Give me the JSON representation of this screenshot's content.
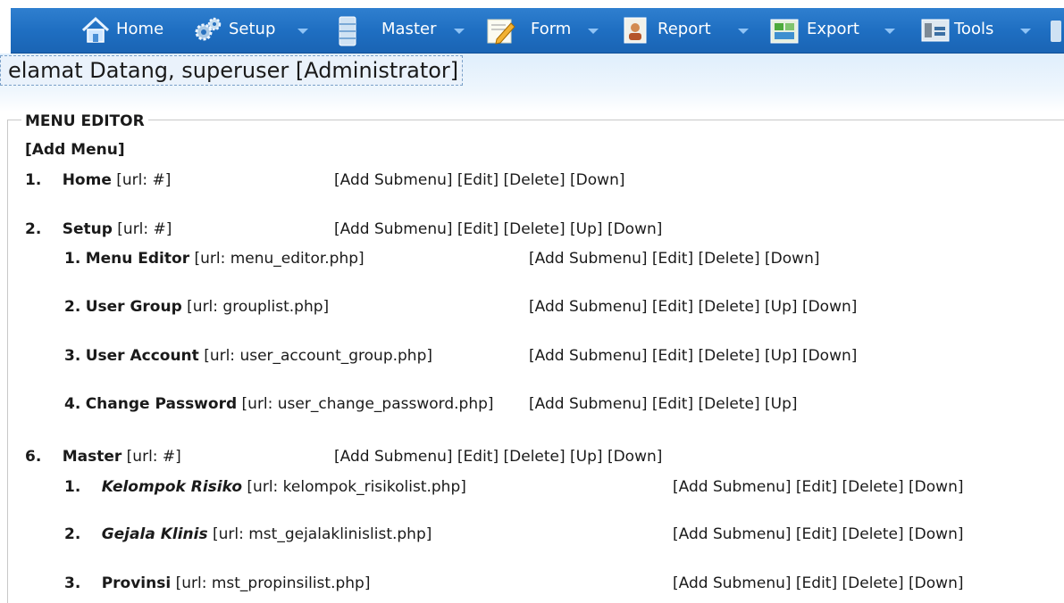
{
  "navbar": {
    "items": [
      {
        "label": "Home",
        "icon": "home-icon"
      },
      {
        "label": "Setup",
        "icon": "gears-icon"
      },
      {
        "label": "Master",
        "icon": "database-icon"
      },
      {
        "label": "Form",
        "icon": "form-edit-icon"
      },
      {
        "label": "Report",
        "icon": "report-icon"
      },
      {
        "label": "Export",
        "icon": "export-icon"
      },
      {
        "label": "Tools",
        "icon": "tools-icon"
      }
    ]
  },
  "welcome": "elamat Datang, superuser [Administrator]",
  "editor": {
    "legend": "MENU EDITOR",
    "add_menu": "[Add Menu]"
  },
  "actions": {
    "add_submenu": "[Add Submenu]",
    "edit": "[Edit]",
    "delete": "[Delete]",
    "up": "[Up]",
    "down": "[Down]"
  },
  "menu": [
    {
      "num": "1.",
      "name": "Home",
      "url": "[url: #]"
    },
    {
      "num": "2.",
      "name": "Setup",
      "url": "[url: #]",
      "children": [
        {
          "num": "1.",
          "name": "Menu Editor",
          "url": "[url: menu_editor.php]"
        },
        {
          "num": "2.",
          "name": "User Group",
          "url": "[url: grouplist.php]"
        },
        {
          "num": "3.",
          "name": "User Account",
          "url": "[url: user_account_group.php]"
        },
        {
          "num": "4.",
          "name": "Change Password",
          "url": "[url: user_change_password.php]"
        }
      ]
    },
    {
      "num": "6.",
      "name": "Master",
      "url": "[url: #]",
      "children": [
        {
          "num": "1.",
          "name": "Kelompok Risiko",
          "url": "[url: kelompok_risikolist.php]"
        },
        {
          "num": "2.",
          "name": "Gejala Klinis",
          "url": "[url: mst_gejalaklinislist.php]"
        },
        {
          "num": "3.",
          "name": "Provinsi",
          "url": "[url: mst_propinsilist.php]"
        }
      ]
    }
  ]
}
